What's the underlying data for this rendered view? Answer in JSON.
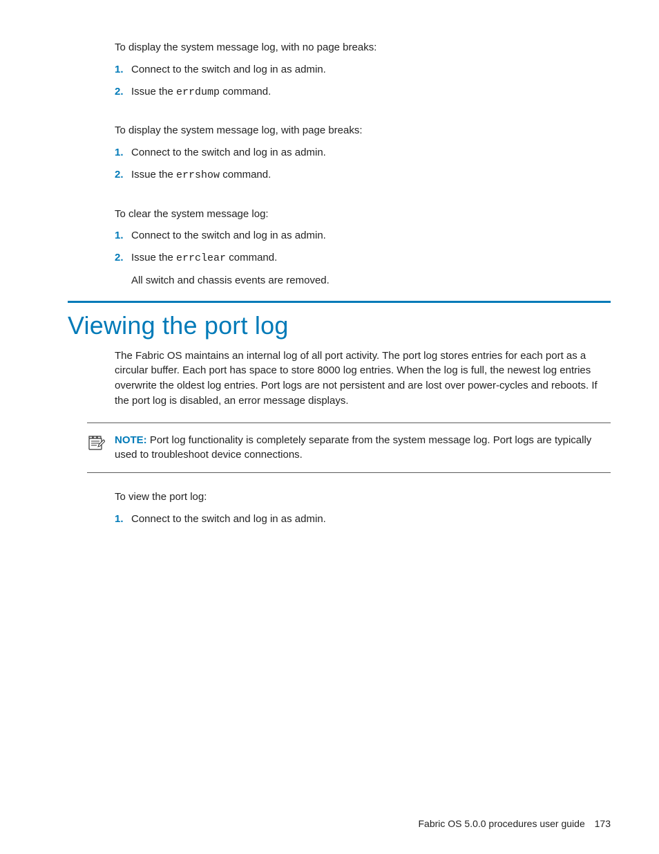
{
  "blocks": [
    {
      "intro": "To display the system message log, with no page breaks:",
      "steps": [
        {
          "num": "1.",
          "pre": "Connect to the switch and log in as admin.",
          "cmd": "",
          "post": "",
          "sub": ""
        },
        {
          "num": "2.",
          "pre": "Issue the ",
          "cmd": "errdump",
          "post": " command.",
          "sub": ""
        }
      ]
    },
    {
      "intro": "To display the system message log, with page breaks:",
      "steps": [
        {
          "num": "1.",
          "pre": "Connect to the switch and log in as admin.",
          "cmd": "",
          "post": "",
          "sub": ""
        },
        {
          "num": "2.",
          "pre": "Issue the ",
          "cmd": "errshow",
          "post": " command.",
          "sub": ""
        }
      ]
    },
    {
      "intro": "To clear the system message log:",
      "steps": [
        {
          "num": "1.",
          "pre": "Connect to the switch and log in as admin.",
          "cmd": "",
          "post": "",
          "sub": ""
        },
        {
          "num": "2.",
          "pre": "Issue the ",
          "cmd": "errclear",
          "post": " command.",
          "sub": "All switch and chassis events are removed."
        }
      ]
    }
  ],
  "section": {
    "heading": "Viewing the port log",
    "para": "The Fabric OS maintains an internal log of all port activity. The port log stores entries for each port as a circular buffer. Each port has space to store 8000 log entries. When the log is full, the newest log entries overwrite the oldest log entries. Port logs are not persistent and are lost over power-cycles and reboots. If the port log is disabled, an error message displays."
  },
  "note": {
    "label": "NOTE:",
    "text": " Port log functionality is completely separate from the system message log. Port logs are typically used to troubleshoot device connections."
  },
  "block4": {
    "intro": "To view the port log:",
    "steps": [
      {
        "num": "1.",
        "pre": "Connect to the switch and log in as admin.",
        "cmd": "",
        "post": "",
        "sub": ""
      }
    ]
  },
  "footer": {
    "title": "Fabric OS 5.0.0 procedures user guide",
    "page": "173"
  }
}
